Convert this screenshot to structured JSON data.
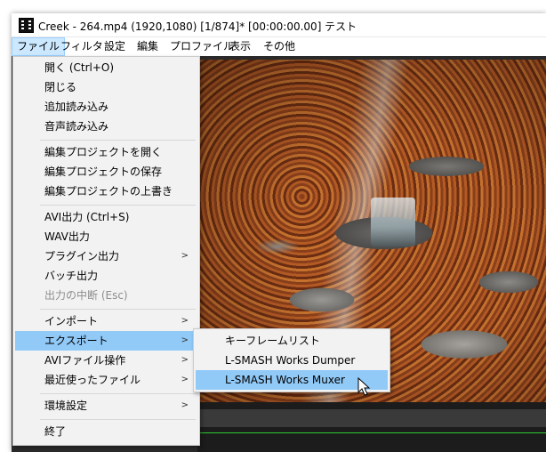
{
  "window": {
    "title": "Creek - 264.mp4 (1920,1080)  [1/874]* [00:00:00.00]  テスト",
    "icon": "film-icon"
  },
  "menubar": {
    "items": [
      {
        "label": "ファイル",
        "active": true
      },
      {
        "label": "フィルタ"
      },
      {
        "label": "設定"
      },
      {
        "label": "編集"
      },
      {
        "label": "プロファイル"
      },
      {
        "label": "表示"
      },
      {
        "label": "その他"
      }
    ]
  },
  "file_menu": {
    "items": [
      {
        "label": "開く (Ctrl+O)"
      },
      {
        "label": "閉じる"
      },
      {
        "label": "追加読み込み"
      },
      {
        "label": "音声読み込み"
      },
      {
        "label": "編集プロジェクトを開く"
      },
      {
        "label": "編集プロジェクトの保存"
      },
      {
        "label": "編集プロジェクトの上書き"
      },
      {
        "label": "AVI出力 (Ctrl+S)"
      },
      {
        "label": "WAV出力"
      },
      {
        "label": "プラグイン出力",
        "submenu": true
      },
      {
        "label": "バッチ出力"
      },
      {
        "label": "出力の中断 (Esc)",
        "disabled": true
      },
      {
        "label": "インポート",
        "submenu": true
      },
      {
        "label": "エクスポート",
        "submenu": true,
        "highlighted": true
      },
      {
        "label": "AVIファイル操作",
        "submenu": true
      },
      {
        "label": "最近使ったファイル",
        "submenu": true
      },
      {
        "label": "環境設定",
        "submenu": true
      },
      {
        "label": "終了"
      }
    ]
  },
  "export_submenu": {
    "items": [
      {
        "label": "キーフレームリスト"
      },
      {
        "label": "L-SMASH Works Dumper"
      },
      {
        "label": "L-SMASH Works Muxer",
        "highlighted": true
      }
    ]
  },
  "colors": {
    "menu_highlight": "#91c9f7",
    "menubar_active": "#cce8ff",
    "timeline_line": "#2ecc2e"
  },
  "cursor": {
    "icon": "mouse-pointer-icon"
  }
}
